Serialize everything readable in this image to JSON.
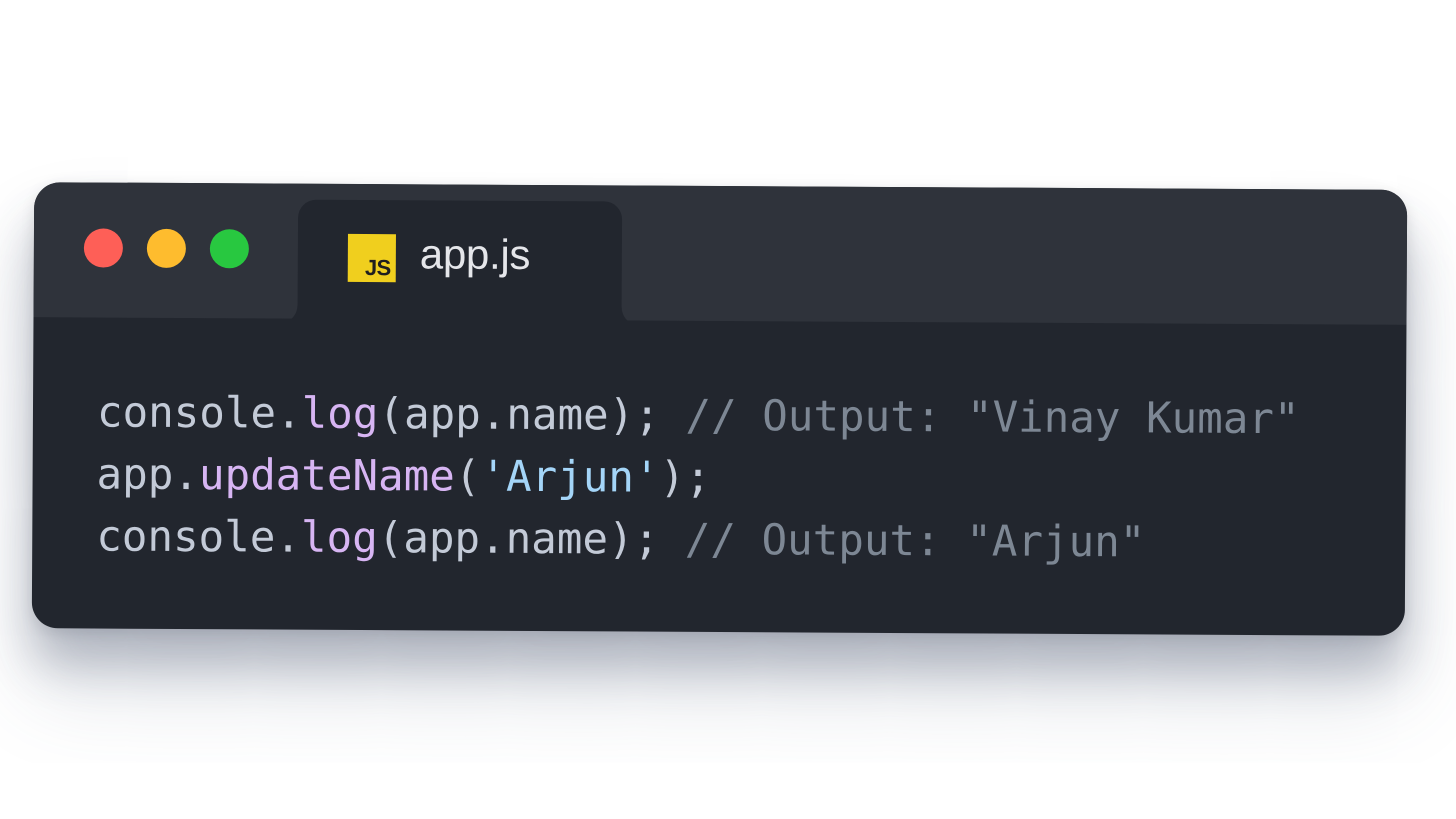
{
  "window": {
    "controls": [
      {
        "name": "close",
        "color": "#fe5f57"
      },
      {
        "name": "minimize",
        "color": "#febc2e"
      },
      {
        "name": "maximize",
        "color": "#28c840"
      }
    ]
  },
  "tab": {
    "icon_label": "JS",
    "title": "app.js"
  },
  "code": {
    "language": "javascript",
    "lines": [
      {
        "tokens": [
          {
            "text": "console.",
            "kind": "plain"
          },
          {
            "text": "log",
            "kind": "fn"
          },
          {
            "text": "(app.name); ",
            "kind": "plain"
          },
          {
            "text": "// Output: \"Vinay Kumar\"",
            "kind": "comment"
          }
        ]
      },
      {
        "tokens": [
          {
            "text": "app.",
            "kind": "plain"
          },
          {
            "text": "updateName",
            "kind": "fn"
          },
          {
            "text": "(",
            "kind": "plain"
          },
          {
            "text": "'Arjun'",
            "kind": "str"
          },
          {
            "text": ");",
            "kind": "plain"
          }
        ]
      },
      {
        "tokens": [
          {
            "text": "console.",
            "kind": "plain"
          },
          {
            "text": "log",
            "kind": "fn"
          },
          {
            "text": "(app.name); ",
            "kind": "plain"
          },
          {
            "text": "// Output: \"Arjun\"",
            "kind": "comment"
          }
        ]
      }
    ]
  },
  "colors": {
    "window_bg": "#22262e",
    "titlebar_bg": "#2f333b",
    "plain": "#c3cad7",
    "function": "#d7b5f3",
    "string": "#a4d5f8",
    "comment": "#7d8794",
    "js_badge": "#f0cf1e"
  }
}
